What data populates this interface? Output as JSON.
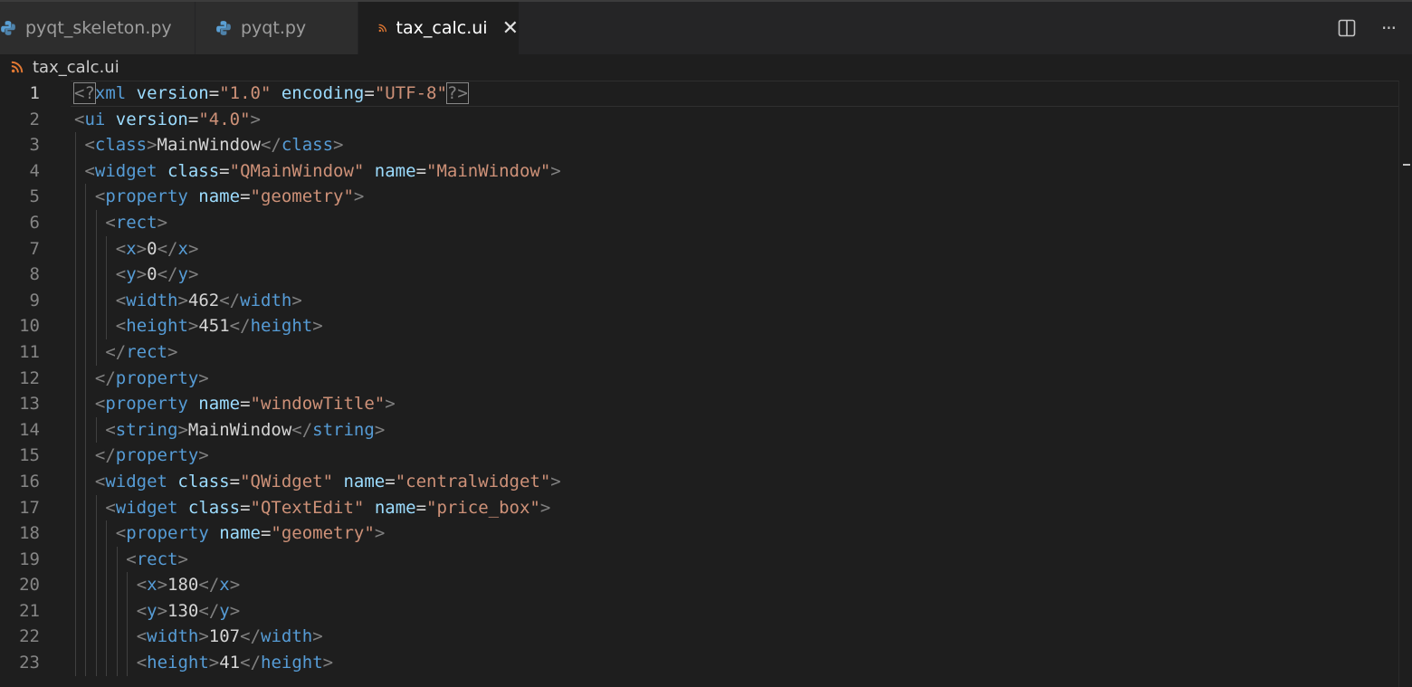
{
  "tabs": [
    {
      "label": "pyqt_skeleton.py",
      "icon": "python-icon",
      "active": false
    },
    {
      "label": "pyqt.py",
      "icon": "python-icon",
      "active": false
    },
    {
      "label": "tax_calc.ui",
      "icon": "rss-xml-icon",
      "active": true
    }
  ],
  "actions": [
    {
      "name": "split-editor-icon"
    },
    {
      "name": "more-actions-icon",
      "glyph": "···"
    }
  ],
  "breadcrumb": {
    "file": "tax_calc.ui",
    "icon": "rss-xml-icon"
  },
  "editor": {
    "current_line": 1,
    "lines": [
      {
        "n": "1",
        "indent": 0,
        "tokens": [
          [
            "pi",
            "<?"
          ],
          [
            "tag",
            "xml "
          ],
          [
            "attr",
            "version"
          ],
          [
            "txt",
            "="
          ],
          [
            "str",
            "\"1.0\""
          ],
          [
            "txt",
            " "
          ],
          [
            "attr",
            "encoding"
          ],
          [
            "txt",
            "="
          ],
          [
            "str",
            "\"UTF-8\""
          ],
          [
            "pi",
            "?>"
          ]
        ]
      },
      {
        "n": "2",
        "indent": 0,
        "tokens": [
          [
            "br",
            "<"
          ],
          [
            "tag",
            "ui "
          ],
          [
            "attr",
            "version"
          ],
          [
            "txt",
            "="
          ],
          [
            "str",
            "\"4.0\""
          ],
          [
            "br",
            ">"
          ]
        ]
      },
      {
        "n": "3",
        "indent": 1,
        "tokens": [
          [
            "br",
            "<"
          ],
          [
            "tag",
            "class"
          ],
          [
            "br",
            ">"
          ],
          [
            "txt",
            "MainWindow"
          ],
          [
            "br",
            "</"
          ],
          [
            "tag",
            "class"
          ],
          [
            "br",
            ">"
          ]
        ]
      },
      {
        "n": "4",
        "indent": 1,
        "tokens": [
          [
            "br",
            "<"
          ],
          [
            "tag",
            "widget "
          ],
          [
            "attr",
            "class"
          ],
          [
            "txt",
            "="
          ],
          [
            "str",
            "\"QMainWindow\""
          ],
          [
            "txt",
            " "
          ],
          [
            "attr",
            "name"
          ],
          [
            "txt",
            "="
          ],
          [
            "str",
            "\"MainWindow\""
          ],
          [
            "br",
            ">"
          ]
        ]
      },
      {
        "n": "5",
        "indent": 2,
        "tokens": [
          [
            "br",
            "<"
          ],
          [
            "tag",
            "property "
          ],
          [
            "attr",
            "name"
          ],
          [
            "txt",
            "="
          ],
          [
            "str",
            "\"geometry\""
          ],
          [
            "br",
            ">"
          ]
        ]
      },
      {
        "n": "6",
        "indent": 3,
        "tokens": [
          [
            "br",
            "<"
          ],
          [
            "tag",
            "rect"
          ],
          [
            "br",
            ">"
          ]
        ]
      },
      {
        "n": "7",
        "indent": 4,
        "tokens": [
          [
            "br",
            "<"
          ],
          [
            "tag",
            "x"
          ],
          [
            "br",
            ">"
          ],
          [
            "txt",
            "0"
          ],
          [
            "br",
            "</"
          ],
          [
            "tag",
            "x"
          ],
          [
            "br",
            ">"
          ]
        ]
      },
      {
        "n": "8",
        "indent": 4,
        "tokens": [
          [
            "br",
            "<"
          ],
          [
            "tag",
            "y"
          ],
          [
            "br",
            ">"
          ],
          [
            "txt",
            "0"
          ],
          [
            "br",
            "</"
          ],
          [
            "tag",
            "y"
          ],
          [
            "br",
            ">"
          ]
        ]
      },
      {
        "n": "9",
        "indent": 4,
        "tokens": [
          [
            "br",
            "<"
          ],
          [
            "tag",
            "width"
          ],
          [
            "br",
            ">"
          ],
          [
            "txt",
            "462"
          ],
          [
            "br",
            "</"
          ],
          [
            "tag",
            "width"
          ],
          [
            "br",
            ">"
          ]
        ]
      },
      {
        "n": "10",
        "indent": 4,
        "tokens": [
          [
            "br",
            "<"
          ],
          [
            "tag",
            "height"
          ],
          [
            "br",
            ">"
          ],
          [
            "txt",
            "451"
          ],
          [
            "br",
            "</"
          ],
          [
            "tag",
            "height"
          ],
          [
            "br",
            ">"
          ]
        ]
      },
      {
        "n": "11",
        "indent": 3,
        "tokens": [
          [
            "br",
            "</"
          ],
          [
            "tag",
            "rect"
          ],
          [
            "br",
            ">"
          ]
        ]
      },
      {
        "n": "12",
        "indent": 2,
        "tokens": [
          [
            "br",
            "</"
          ],
          [
            "tag",
            "property"
          ],
          [
            "br",
            ">"
          ]
        ]
      },
      {
        "n": "13",
        "indent": 2,
        "tokens": [
          [
            "br",
            "<"
          ],
          [
            "tag",
            "property "
          ],
          [
            "attr",
            "name"
          ],
          [
            "txt",
            "="
          ],
          [
            "str",
            "\"windowTitle\""
          ],
          [
            "br",
            ">"
          ]
        ]
      },
      {
        "n": "14",
        "indent": 3,
        "tokens": [
          [
            "br",
            "<"
          ],
          [
            "tag",
            "string"
          ],
          [
            "br",
            ">"
          ],
          [
            "txt",
            "MainWindow"
          ],
          [
            "br",
            "</"
          ],
          [
            "tag",
            "string"
          ],
          [
            "br",
            ">"
          ]
        ]
      },
      {
        "n": "15",
        "indent": 2,
        "tokens": [
          [
            "br",
            "</"
          ],
          [
            "tag",
            "property"
          ],
          [
            "br",
            ">"
          ]
        ]
      },
      {
        "n": "16",
        "indent": 2,
        "tokens": [
          [
            "br",
            "<"
          ],
          [
            "tag",
            "widget "
          ],
          [
            "attr",
            "class"
          ],
          [
            "txt",
            "="
          ],
          [
            "str",
            "\"QWidget\""
          ],
          [
            "txt",
            " "
          ],
          [
            "attr",
            "name"
          ],
          [
            "txt",
            "="
          ],
          [
            "str",
            "\"centralwidget\""
          ],
          [
            "br",
            ">"
          ]
        ]
      },
      {
        "n": "17",
        "indent": 3,
        "tokens": [
          [
            "br",
            "<"
          ],
          [
            "tag",
            "widget "
          ],
          [
            "attr",
            "class"
          ],
          [
            "txt",
            "="
          ],
          [
            "str",
            "\"QTextEdit\""
          ],
          [
            "txt",
            " "
          ],
          [
            "attr",
            "name"
          ],
          [
            "txt",
            "="
          ],
          [
            "str",
            "\"price_box\""
          ],
          [
            "br",
            ">"
          ]
        ]
      },
      {
        "n": "18",
        "indent": 4,
        "tokens": [
          [
            "br",
            "<"
          ],
          [
            "tag",
            "property "
          ],
          [
            "attr",
            "name"
          ],
          [
            "txt",
            "="
          ],
          [
            "str",
            "\"geometry\""
          ],
          [
            "br",
            ">"
          ]
        ]
      },
      {
        "n": "19",
        "indent": 5,
        "tokens": [
          [
            "br",
            "<"
          ],
          [
            "tag",
            "rect"
          ],
          [
            "br",
            ">"
          ]
        ]
      },
      {
        "n": "20",
        "indent": 6,
        "tokens": [
          [
            "br",
            "<"
          ],
          [
            "tag",
            "x"
          ],
          [
            "br",
            ">"
          ],
          [
            "txt",
            "180"
          ],
          [
            "br",
            "</"
          ],
          [
            "tag",
            "x"
          ],
          [
            "br",
            ">"
          ]
        ]
      },
      {
        "n": "21",
        "indent": 6,
        "tokens": [
          [
            "br",
            "<"
          ],
          [
            "tag",
            "y"
          ],
          [
            "br",
            ">"
          ],
          [
            "txt",
            "130"
          ],
          [
            "br",
            "</"
          ],
          [
            "tag",
            "y"
          ],
          [
            "br",
            ">"
          ]
        ]
      },
      {
        "n": "22",
        "indent": 6,
        "tokens": [
          [
            "br",
            "<"
          ],
          [
            "tag",
            "width"
          ],
          [
            "br",
            ">"
          ],
          [
            "txt",
            "107"
          ],
          [
            "br",
            "</"
          ],
          [
            "tag",
            "width"
          ],
          [
            "br",
            ">"
          ]
        ]
      },
      {
        "n": "23",
        "indent": 6,
        "tokens": [
          [
            "br",
            "<"
          ],
          [
            "tag",
            "height"
          ],
          [
            "br",
            ">"
          ],
          [
            "txt",
            "41"
          ],
          [
            "br",
            "</"
          ],
          [
            "tag",
            "height"
          ],
          [
            "br",
            ">"
          ]
        ]
      }
    ]
  }
}
